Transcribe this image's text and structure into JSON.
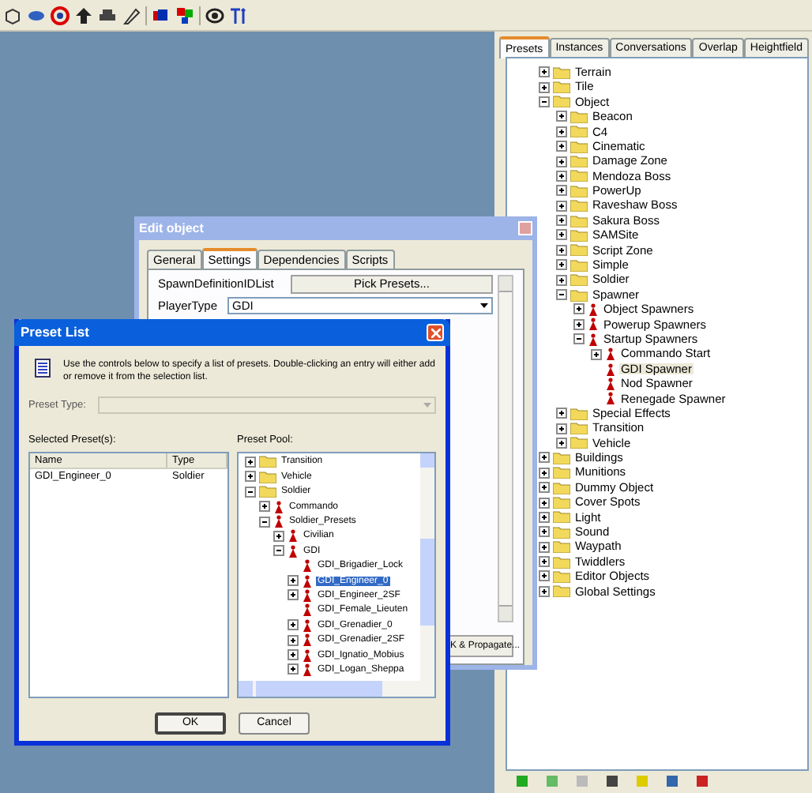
{
  "right_panel": {
    "tabs": [
      {
        "label": "Presets",
        "selected": true
      },
      {
        "label": "Instances",
        "selected": false
      },
      {
        "label": "Conversations",
        "selected": false
      },
      {
        "label": "Overlap",
        "selected": false
      },
      {
        "label": "Heightfield",
        "selected": false
      }
    ],
    "tree": [
      {
        "label": "Terrain",
        "kind": "folder",
        "expanded": false,
        "selected": false
      },
      {
        "label": "Tile",
        "kind": "folder",
        "expanded": false,
        "selected": false
      },
      {
        "label": "Object",
        "kind": "folder",
        "expanded": true,
        "selected": false,
        "children": [
          {
            "label": "Beacon",
            "kind": "folder",
            "expanded": false,
            "selected": false
          },
          {
            "label": "C4",
            "kind": "folder",
            "expanded": false,
            "selected": false
          },
          {
            "label": "Cinematic",
            "kind": "folder",
            "expanded": false,
            "selected": false
          },
          {
            "label": "Damage Zone",
            "kind": "folder",
            "expanded": false,
            "selected": false
          },
          {
            "label": "Mendoza Boss",
            "kind": "folder",
            "expanded": false,
            "selected": false
          },
          {
            "label": "PowerUp",
            "kind": "folder",
            "expanded": false,
            "selected": false
          },
          {
            "label": "Raveshaw Boss",
            "kind": "folder",
            "expanded": false,
            "selected": false
          },
          {
            "label": "Sakura Boss",
            "kind": "folder",
            "expanded": false,
            "selected": false
          },
          {
            "label": "SAMSite",
            "kind": "folder",
            "expanded": false,
            "selected": false
          },
          {
            "label": "Script Zone",
            "kind": "folder",
            "expanded": false,
            "selected": false
          },
          {
            "label": "Simple",
            "kind": "folder",
            "expanded": false,
            "selected": false
          },
          {
            "label": "Soldier",
            "kind": "folder",
            "expanded": false,
            "selected": false
          },
          {
            "label": "Spawner",
            "kind": "folder",
            "expanded": true,
            "selected": false,
            "children": [
              {
                "label": "Object Spawners",
                "kind": "preset",
                "expanded": false,
                "selected": false
              },
              {
                "label": "Powerup Spawners",
                "kind": "preset",
                "expanded": false,
                "selected": false
              },
              {
                "label": "Startup Spawners",
                "kind": "preset",
                "expanded": true,
                "selected": false,
                "children": [
                  {
                    "label": "Commando Start",
                    "kind": "preset",
                    "expanded": false,
                    "selected": false
                  },
                  {
                    "label": "GDI Spawner",
                    "kind": "preset",
                    "selected": true
                  },
                  {
                    "label": "Nod Spawner",
                    "kind": "preset",
                    "selected": false
                  },
                  {
                    "label": "Renegade Spawner",
                    "kind": "preset",
                    "selected": false
                  }
                ]
              }
            ]
          },
          {
            "label": "Special Effects",
            "kind": "folder",
            "expanded": false,
            "selected": false
          },
          {
            "label": "Transition",
            "kind": "folder",
            "expanded": false,
            "selected": false
          },
          {
            "label": "Vehicle",
            "kind": "folder",
            "expanded": false,
            "selected": false
          }
        ]
      },
      {
        "label": "Buildings",
        "kind": "folder",
        "expanded": false,
        "selected": false
      },
      {
        "label": "Munitions",
        "kind": "folder",
        "expanded": false,
        "selected": false
      },
      {
        "label": "Dummy Object",
        "kind": "folder",
        "expanded": false,
        "selected": false
      },
      {
        "label": "Cover Spots",
        "kind": "folder",
        "expanded": false,
        "selected": false
      },
      {
        "label": "Light",
        "kind": "folder",
        "expanded": false,
        "selected": false
      },
      {
        "label": "Sound",
        "kind": "folder",
        "expanded": false,
        "selected": false
      },
      {
        "label": "Waypath",
        "kind": "folder",
        "expanded": false,
        "selected": false
      },
      {
        "label": "Twiddlers",
        "kind": "folder",
        "expanded": false,
        "selected": false
      },
      {
        "label": "Editor Objects",
        "kind": "folder",
        "expanded": false,
        "selected": false
      },
      {
        "label": "Global Settings",
        "kind": "folder",
        "expanded": false,
        "selected": false
      }
    ]
  },
  "edit_object": {
    "title": "Edit object",
    "tabs": [
      {
        "label": "General",
        "selected": false
      },
      {
        "label": "Settings",
        "selected": true
      },
      {
        "label": "Dependencies",
        "selected": false
      },
      {
        "label": "Scripts",
        "selected": false
      }
    ],
    "spawn_label": "SpawnDefinitionIDList",
    "pick_button": "Pick Presets...",
    "player_type_label": "PlayerType",
    "player_type_value": "GDI",
    "propagate_button": "K & Propagate..."
  },
  "preset_list": {
    "title": "Preset List",
    "description": "Use the controls below to specify a list of presets.  Double-clicking an entry will either add or remove it from the selection list.",
    "preset_type_label": "Preset Type:",
    "selected_label": "Selected Preset(s):",
    "columns": [
      "Name",
      "Type"
    ],
    "rows": [
      {
        "name": "GDI_Engineer_0",
        "type": "Soldier"
      }
    ],
    "pool_label": "Preset Pool:",
    "pool": [
      {
        "label": "Transition",
        "kind": "folder",
        "expanded": false,
        "selected": false
      },
      {
        "label": "Vehicle",
        "kind": "folder",
        "expanded": false,
        "selected": false
      },
      {
        "label": "Soldier",
        "kind": "folder",
        "expanded": true,
        "selected": false,
        "children": [
          {
            "label": "Commando",
            "kind": "preset",
            "expanded": false,
            "selected": false
          },
          {
            "label": "Soldier_Presets",
            "kind": "preset",
            "expanded": true,
            "selected": false,
            "children": [
              {
                "label": "Civilian",
                "kind": "preset",
                "expanded": false,
                "selected": false
              },
              {
                "label": "GDI",
                "kind": "preset",
                "expanded": true,
                "selected": false,
                "children": [
                  {
                    "label": "GDI_Brigadier_Lock",
                    "kind": "preset",
                    "selected": false
                  },
                  {
                    "label": "GDI_Engineer_0",
                    "kind": "preset",
                    "expanded": false,
                    "selected": true
                  },
                  {
                    "label": "GDI_Engineer_2SF",
                    "kind": "preset",
                    "expanded": false,
                    "selected": false
                  },
                  {
                    "label": "GDI_Female_Lieuten",
                    "kind": "preset",
                    "selected": false
                  },
                  {
                    "label": "GDI_Grenadier_0",
                    "kind": "preset",
                    "expanded": false,
                    "selected": false
                  },
                  {
                    "label": "GDI_Grenadier_2SF",
                    "kind": "preset",
                    "expanded": false,
                    "selected": false
                  },
                  {
                    "label": "GDI_Ignatio_Mobius",
                    "kind": "preset",
                    "expanded": false,
                    "selected": false
                  },
                  {
                    "label": "GDI_Logan_Sheppa",
                    "kind": "preset",
                    "expanded": false,
                    "selected": false
                  }
                ]
              }
            ]
          }
        ]
      }
    ],
    "buttons": [
      "OK",
      "Cancel"
    ]
  }
}
